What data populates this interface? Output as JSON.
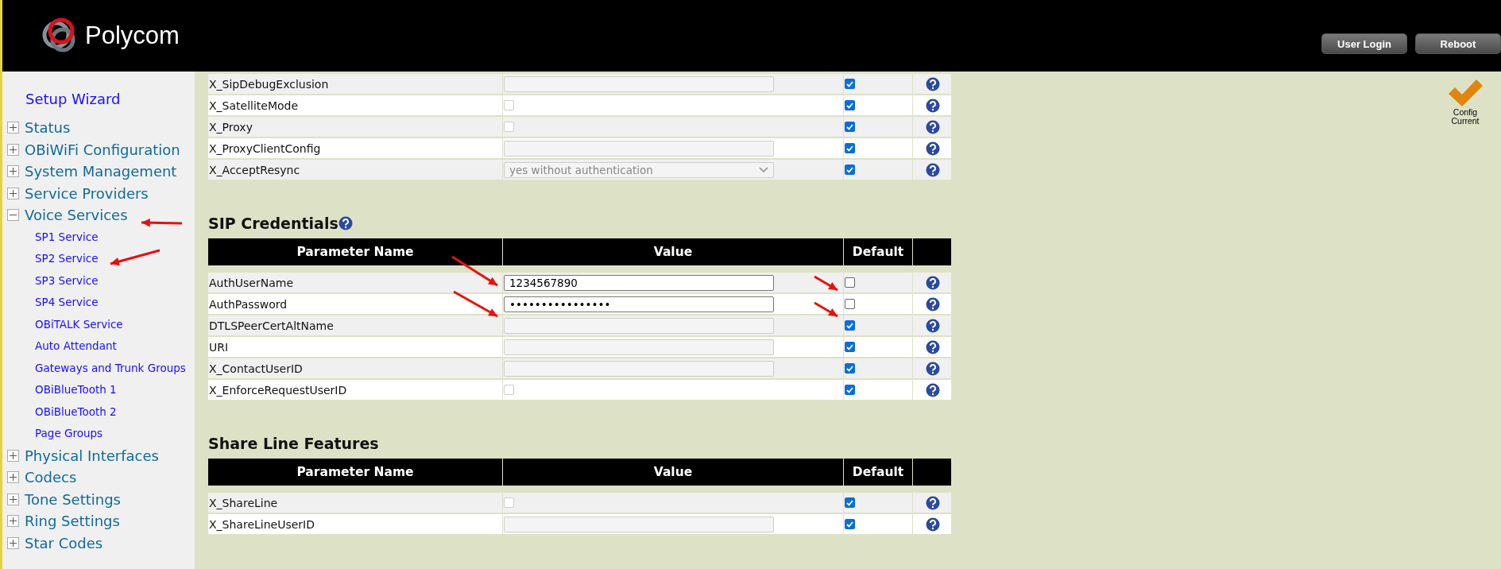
{
  "header": {
    "brand": "Polycom",
    "buttons": [
      "User Login",
      "Reboot"
    ]
  },
  "sidebar": {
    "wizard": "Setup Wizard",
    "items": [
      {
        "label": "Status",
        "expanded": false
      },
      {
        "label": "OBiWiFi Configuration",
        "expanded": false
      },
      {
        "label": "System Management",
        "expanded": false
      },
      {
        "label": "Service Providers",
        "expanded": false
      },
      {
        "label": "Voice Services",
        "expanded": true,
        "children": [
          {
            "label": "SP1 Service"
          },
          {
            "label": "SP2 Service"
          },
          {
            "label": "SP3 Service"
          },
          {
            "label": "SP4 Service"
          },
          {
            "label": "OBiTALK Service"
          },
          {
            "label": "Auto Attendant"
          },
          {
            "label": "Gateways and Trunk Groups"
          },
          {
            "label": "OBiBlueTooth 1"
          },
          {
            "label": "OBiBlueTooth 2"
          },
          {
            "label": "Page Groups"
          }
        ]
      },
      {
        "label": "Physical Interfaces",
        "expanded": false
      },
      {
        "label": "Codecs",
        "expanded": false
      },
      {
        "label": "Tone Settings",
        "expanded": false
      },
      {
        "label": "Ring Settings",
        "expanded": false
      },
      {
        "label": "Star Codes",
        "expanded": false
      }
    ]
  },
  "status": {
    "label_lines": [
      "Config",
      "Current"
    ]
  },
  "sections": [
    {
      "rows": [
        {
          "name": "X_SipDebugExclusion",
          "kind": "text",
          "value": "",
          "enabled": false,
          "default": true
        },
        {
          "name": "X_SatelliteMode",
          "kind": "checkbox",
          "checked": false,
          "enabled": false,
          "default": true
        },
        {
          "name": "X_Proxy",
          "kind": "checkbox",
          "checked": false,
          "enabled": false,
          "default": true
        },
        {
          "name": "X_ProxyClientConfig",
          "kind": "text",
          "value": "",
          "enabled": false,
          "default": true
        },
        {
          "name": "X_AcceptResync",
          "kind": "select",
          "value": "yes without authentication",
          "enabled": false,
          "default": true
        }
      ]
    },
    {
      "title": "SIP Credentials",
      "help": true,
      "columns": [
        "Parameter Name",
        "Value",
        "Default"
      ],
      "rows": [
        {
          "name": "AuthUserName",
          "kind": "text",
          "value": "1234567890",
          "enabled": true,
          "default": false
        },
        {
          "name": "AuthPassword",
          "kind": "text",
          "value": "••••••••••••••••",
          "enabled": true,
          "default": false
        },
        {
          "name": "DTLSPeerCertAltName",
          "kind": "text",
          "value": "",
          "enabled": false,
          "default": true
        },
        {
          "name": "URI",
          "kind": "text",
          "value": "",
          "enabled": false,
          "default": true
        },
        {
          "name": "X_ContactUserID",
          "kind": "text",
          "value": "",
          "enabled": false,
          "default": true
        },
        {
          "name": "X_EnforceRequestUserID",
          "kind": "checkbox",
          "checked": false,
          "enabled": false,
          "default": true
        }
      ]
    },
    {
      "title": "Share Line Features",
      "columns": [
        "Parameter Name",
        "Value",
        "Default"
      ],
      "rows": [
        {
          "name": "X_ShareLine",
          "kind": "checkbox",
          "checked": false,
          "enabled": false,
          "default": true
        },
        {
          "name": "X_ShareLineUserID",
          "kind": "text",
          "value": "",
          "enabled": false,
          "default": true
        }
      ]
    }
  ]
}
